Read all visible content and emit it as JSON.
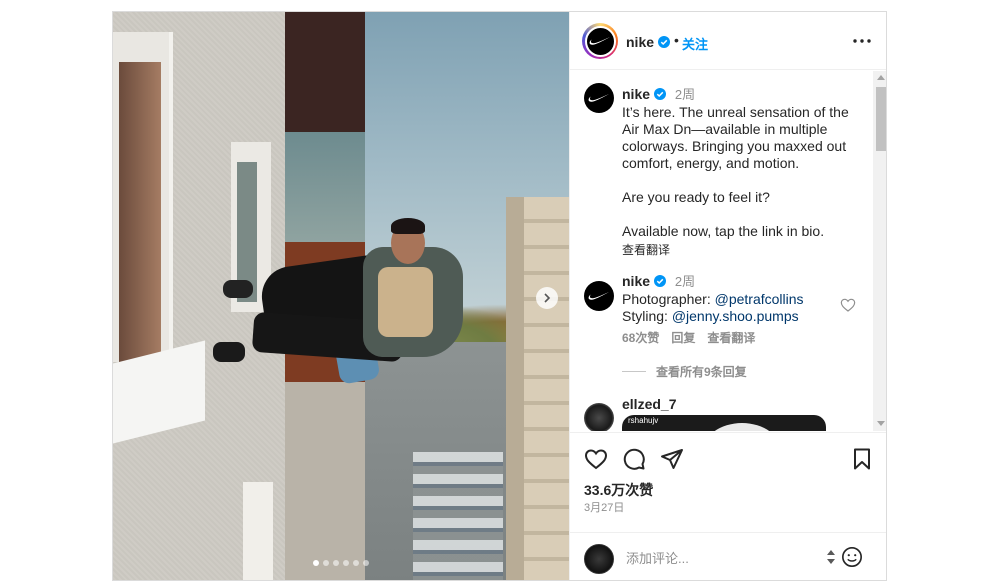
{
  "post": {
    "username": "nike",
    "verified": true,
    "follow_dot": "•",
    "follow_label": "关注",
    "caption_time": "2周",
    "caption_lines": [
      "It’s here. The unreal sensation of the",
      "Air Max Dn—available in multiple",
      "colorways. Bringing you maxxed out",
      "comfort, energy, and motion.",
      "",
      "Are you ready to feel it?",
      "",
      "Available now, tap the link in bio."
    ],
    "see_translation": "查看翻译",
    "comments": [
      {
        "username": "nike",
        "time": "2周",
        "line1_prefix": "Photographer: ",
        "line1_link": "@petrafcollins",
        "line2_prefix": "Styling: ",
        "line2_link": "@jenny.shoo.pumps",
        "likes": "68次赞",
        "reply_label": "回复",
        "translate_label": "查看翻译",
        "view_replies": "查看所有9条回复"
      },
      {
        "username": "ellzed_7",
        "media_caption": "rshahujv"
      }
    ],
    "likes_count": "33.6万次赞",
    "date": "3月27日",
    "comment_placeholder": "添加评论...",
    "carousel": {
      "total": 6,
      "active": 0
    },
    "icons": {
      "logo": "nike-swoosh-icon",
      "more": "more-options-icon",
      "like": "heart-icon",
      "comment": "comment-icon",
      "share": "share-icon",
      "save": "bookmark-icon",
      "emoji": "emoji-icon",
      "next": "chevron-right-icon"
    },
    "colors": {
      "accent": "#0095f6",
      "text": "#262626",
      "muted": "#8e8e8e"
    }
  }
}
